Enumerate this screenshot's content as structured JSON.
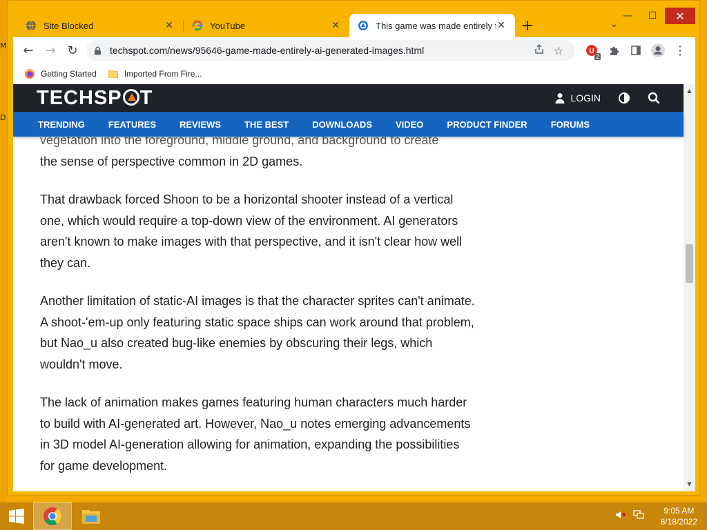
{
  "desktop": {
    "left_glyphs": [
      "M",
      "D"
    ]
  },
  "window": {
    "controls": {
      "minimize": "—",
      "maximize": "☐",
      "close": "✕"
    },
    "tab_menu": "⌄"
  },
  "tabs": [
    {
      "title": "Site Blocked",
      "icon": "globe-icon",
      "close": "✕",
      "active": false
    },
    {
      "title": "YouTube",
      "icon": "google-g-icon",
      "close": "✕",
      "active": false
    },
    {
      "title": "This game was made entirely fro",
      "icon": "techspot-icon",
      "close": "✕",
      "active": true
    }
  ],
  "new_tab_label": "+",
  "toolbar": {
    "back": "←",
    "forward": "→",
    "reload": "↻",
    "url": "techspot.com/news/95646-game-made-entirely-ai-generated-images.html",
    "ext_badge": "2"
  },
  "bookmarks": [
    {
      "label": "Getting Started",
      "icon": "firefox-icon"
    },
    {
      "label": "Imported From Fire...",
      "icon": "folder-icon"
    }
  ],
  "site": {
    "logo": {
      "pre": "TECHSP",
      "post": "T"
    },
    "login_label": "LOGIN",
    "nav": [
      "TRENDING",
      "FEATURES",
      "REVIEWS",
      "THE BEST",
      "DOWNLOADS",
      "VIDEO",
      "PRODUCT FINDER",
      "FORUMS"
    ]
  },
  "article": {
    "cut_line": "vegetation into the foreground, middle ground, and background to create",
    "paragraphs": [
      "the sense of perspective common in 2D games.",
      "That drawback forced Shoon to be a horizontal shooter instead of a vertical one, which would require a top-down view of the environment. AI generators aren't known to make images with that perspective, and it isn't clear how well they can.",
      "Another limitation of static-AI images is that the character sprites can't animate. A shoot-'em-up only featuring static space ships can work around that problem, but Nao_u also created bug-like enemies by obscuring their legs, which wouldn't move.",
      "The lack of animation makes games featuring human characters much harder to build with AI-generated art. However, Nao_u notes emerging advancements in 3D model AI-generation allowing for animation, expanding the possibilities for game development."
    ]
  },
  "taskbar": {
    "time": "9:05 AM",
    "date": "8/18/2022"
  },
  "colors": {
    "desktop": "#f2a900",
    "site_header": "#1f2229",
    "site_nav": "#1565c0",
    "close_button": "#c42b1c"
  }
}
